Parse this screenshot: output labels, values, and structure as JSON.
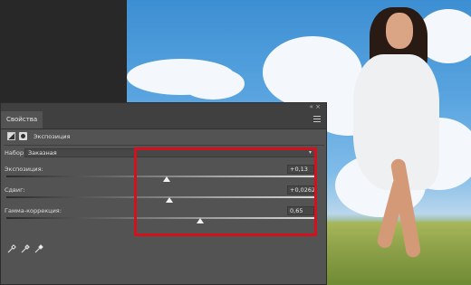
{
  "panel": {
    "tab_label": "Свойства",
    "collapse_label": "«",
    "close_label": "×",
    "adjustment_title": "Экспозиция",
    "preset_label": "Набор:",
    "preset_value": "Заказная",
    "sliders": [
      {
        "label": "Экспозиция:",
        "value": "+0,13",
        "position": 0.52
      },
      {
        "label": "Сдвиг:",
        "value": "+0,0262",
        "position": 0.53
      },
      {
        "label": "Гамма-коррекция:",
        "value": "0,65",
        "position": 0.63
      }
    ]
  },
  "colors": {
    "panel_bg": "#535353",
    "highlight_box": "#d4101c"
  },
  "icons": [
    "adjustment-layer-icon",
    "mask-icon",
    "menu-icon",
    "eyedropper-black-icon",
    "eyedropper-gray-icon",
    "eyedropper-white-icon"
  ]
}
